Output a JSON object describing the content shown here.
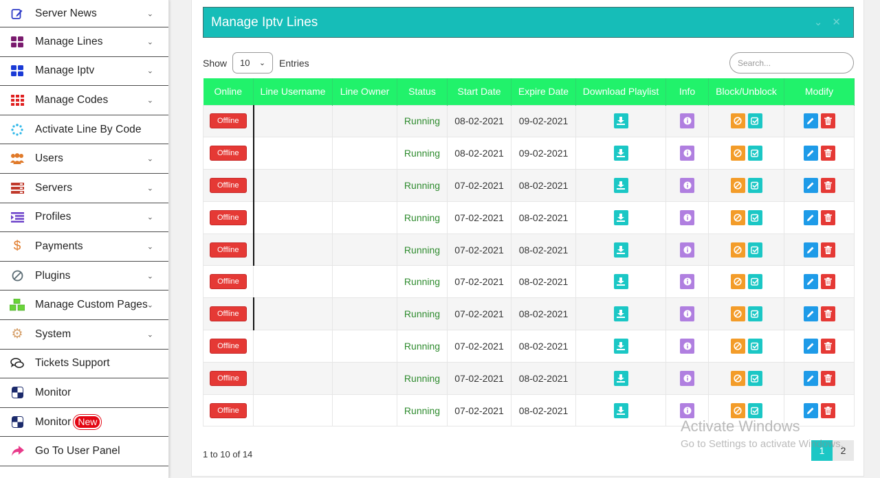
{
  "sidebar": {
    "items": [
      {
        "label": "Server News",
        "icon": "edit-icon",
        "chevron": true
      },
      {
        "label": "Manage Lines",
        "icon": "grid-icon",
        "chevron": true
      },
      {
        "label": "Manage Iptv",
        "icon": "grid-icon",
        "chevron": true
      },
      {
        "label": "Manage Codes",
        "icon": "grid-dots-icon",
        "chevron": true
      },
      {
        "label": "Activate Line By Code",
        "icon": "spinner-icon",
        "chevron": false
      },
      {
        "label": "Users",
        "icon": "users-icon",
        "chevron": true
      },
      {
        "label": "Servers",
        "icon": "server-icon",
        "chevron": true
      },
      {
        "label": "Profiles",
        "icon": "list-icon",
        "chevron": true
      },
      {
        "label": "Payments",
        "icon": "dollar-icon",
        "chevron": true
      },
      {
        "label": "Plugins",
        "icon": "ban-icon",
        "chevron": true
      },
      {
        "label": "Manage Custom Pages",
        "icon": "cubes-icon",
        "chevron": true
      },
      {
        "label": "System",
        "icon": "gear-icon",
        "chevron": true
      },
      {
        "label": "Tickets Support",
        "icon": "chat-icon",
        "chevron": false
      },
      {
        "label": "Monitor",
        "icon": "monitor-icon",
        "chevron": false
      },
      {
        "label": "Monitor",
        "icon": "monitor-icon",
        "chevron": false,
        "badge": "New"
      },
      {
        "label": "Go To User Panel",
        "icon": "share-icon",
        "chevron": false
      }
    ]
  },
  "panel": {
    "title": "Manage Iptv Lines"
  },
  "controls": {
    "show_label": "Show",
    "entries_value": "10",
    "entries_label": "Entries",
    "search_placeholder": "Search..."
  },
  "table": {
    "headers": [
      "Online",
      "Line Username",
      "Line Owner",
      "Status",
      "Start Date",
      "Expire Date",
      "Download Playlist",
      "Info",
      "Block/Unblock",
      "Modify"
    ],
    "rows": [
      {
        "online": "Offline",
        "status": "Running",
        "start": "08-02-2021",
        "expire": "09-02-2021"
      },
      {
        "online": "Offline",
        "status": "Running",
        "start": "08-02-2021",
        "expire": "09-02-2021"
      },
      {
        "online": "Offline",
        "status": "Running",
        "start": "07-02-2021",
        "expire": "08-02-2021"
      },
      {
        "online": "Offline",
        "status": "Running",
        "start": "07-02-2021",
        "expire": "08-02-2021"
      },
      {
        "online": "Offline",
        "status": "Running",
        "start": "07-02-2021",
        "expire": "08-02-2021"
      },
      {
        "online": "Offline",
        "status": "Running",
        "start": "07-02-2021",
        "expire": "08-02-2021"
      },
      {
        "online": "Offline",
        "status": "Running",
        "start": "07-02-2021",
        "expire": "08-02-2021"
      },
      {
        "online": "Offline",
        "status": "Running",
        "start": "07-02-2021",
        "expire": "08-02-2021"
      },
      {
        "online": "Offline",
        "status": "Running",
        "start": "07-02-2021",
        "expire": "08-02-2021"
      },
      {
        "online": "Offline",
        "status": "Running",
        "start": "07-02-2021",
        "expire": "08-02-2021"
      }
    ]
  },
  "footer": {
    "info": "1 to 10 of 14",
    "pages": [
      "1",
      "2"
    ]
  },
  "watermark": {
    "title": "Activate Windows",
    "subtitle": "Go to Settings to activate Windows."
  },
  "colors": {
    "panel_header": "#16bdb8",
    "table_header": "#21f26b",
    "offline_button": "#e53935",
    "status_text": "#2e8b2e"
  }
}
